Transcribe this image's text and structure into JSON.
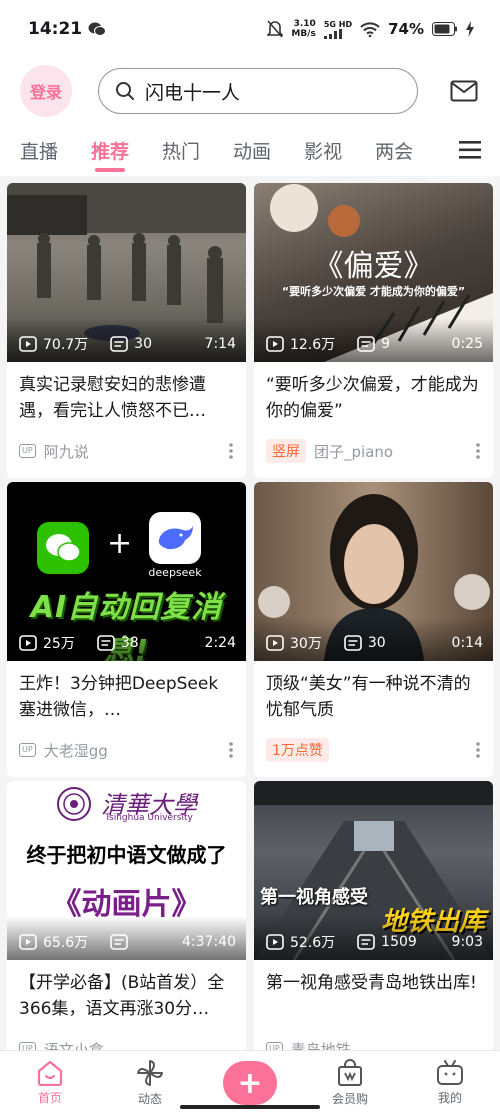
{
  "status_bar": {
    "time": "14:21",
    "net_speed_value": "3.10",
    "net_speed_unit": "MB/s",
    "network_type": "5G HD",
    "battery": "74%"
  },
  "header": {
    "login_label": "登录",
    "search_placeholder": "闪电十一人"
  },
  "tabs": [
    {
      "label": "直播",
      "active": false
    },
    {
      "label": "推荐",
      "active": true
    },
    {
      "label": "热门",
      "active": false
    },
    {
      "label": "动画",
      "active": false
    },
    {
      "label": "影视",
      "active": false
    },
    {
      "label": "两会",
      "active": false
    }
  ],
  "cards": [
    {
      "thumb_text": "",
      "views": "70.7万",
      "danmaku": "30",
      "duration": "7:14",
      "title": "真实记录慰安妇的悲惨遭遇，看完让人愤怒不已…",
      "badge": "",
      "author": "阿九说"
    },
    {
      "thumb_text": "《偏爱》",
      "thumb_subtext": "“要听多少次偏爱 才能成为你的偏爱”",
      "views": "12.6万",
      "danmaku": "9",
      "duration": "0:25",
      "title": "“要听多少次偏爱，才能成为你的偏爱”",
      "badge": "竖屏",
      "author": "团子_piano"
    },
    {
      "thumb_text": "AI自动回复消息!",
      "thumb_subtext": "deepseek",
      "views": "25万",
      "danmaku": "38",
      "duration": "2:24",
      "title": "王炸！3分钟把DeepSeek塞进微信，…",
      "badge": "",
      "author": "大老湿gg"
    },
    {
      "thumb_text": "",
      "views": "30万",
      "danmaku": "30",
      "duration": "0:14",
      "title": "顶级“美女”有一种说不清的忧郁气质",
      "badge": "1万点赞",
      "author": ""
    },
    {
      "thumb_text": "终于把初中语文做成了",
      "thumb_subtext": "《动画片》",
      "thumb_logo": "清華大學",
      "thumb_logo_en": "Tsinghua University",
      "views": "65.6万",
      "danmaku": "",
      "duration": "4:37:40",
      "title": "【开学必备】(B站首发）全366集，语文再涨30分…",
      "badge": "",
      "author": "语文小盒"
    },
    {
      "thumb_text": "地铁出库",
      "thumb_subtext": "第一视角感受",
      "views": "52.6万",
      "danmaku": "1509",
      "duration": "9:03",
      "title": "第一视角感受青岛地铁出库!",
      "badge": "",
      "author": "青岛地铁"
    }
  ],
  "bottom_nav": [
    {
      "label": "首页",
      "icon": "home-icon",
      "active": true
    },
    {
      "label": "动态",
      "icon": "pinwheel-icon",
      "active": false
    },
    {
      "label": "+",
      "icon": "plus-icon",
      "active": false
    },
    {
      "label": "会员购",
      "icon": "shopping-bag-icon",
      "active": false
    },
    {
      "label": "我的",
      "icon": "tv-icon",
      "active": false
    }
  ],
  "colors": {
    "accent": "#fb7299",
    "text_primary": "#18191c",
    "text_secondary": "#9499a0",
    "badge_orange": "#ff6633"
  }
}
